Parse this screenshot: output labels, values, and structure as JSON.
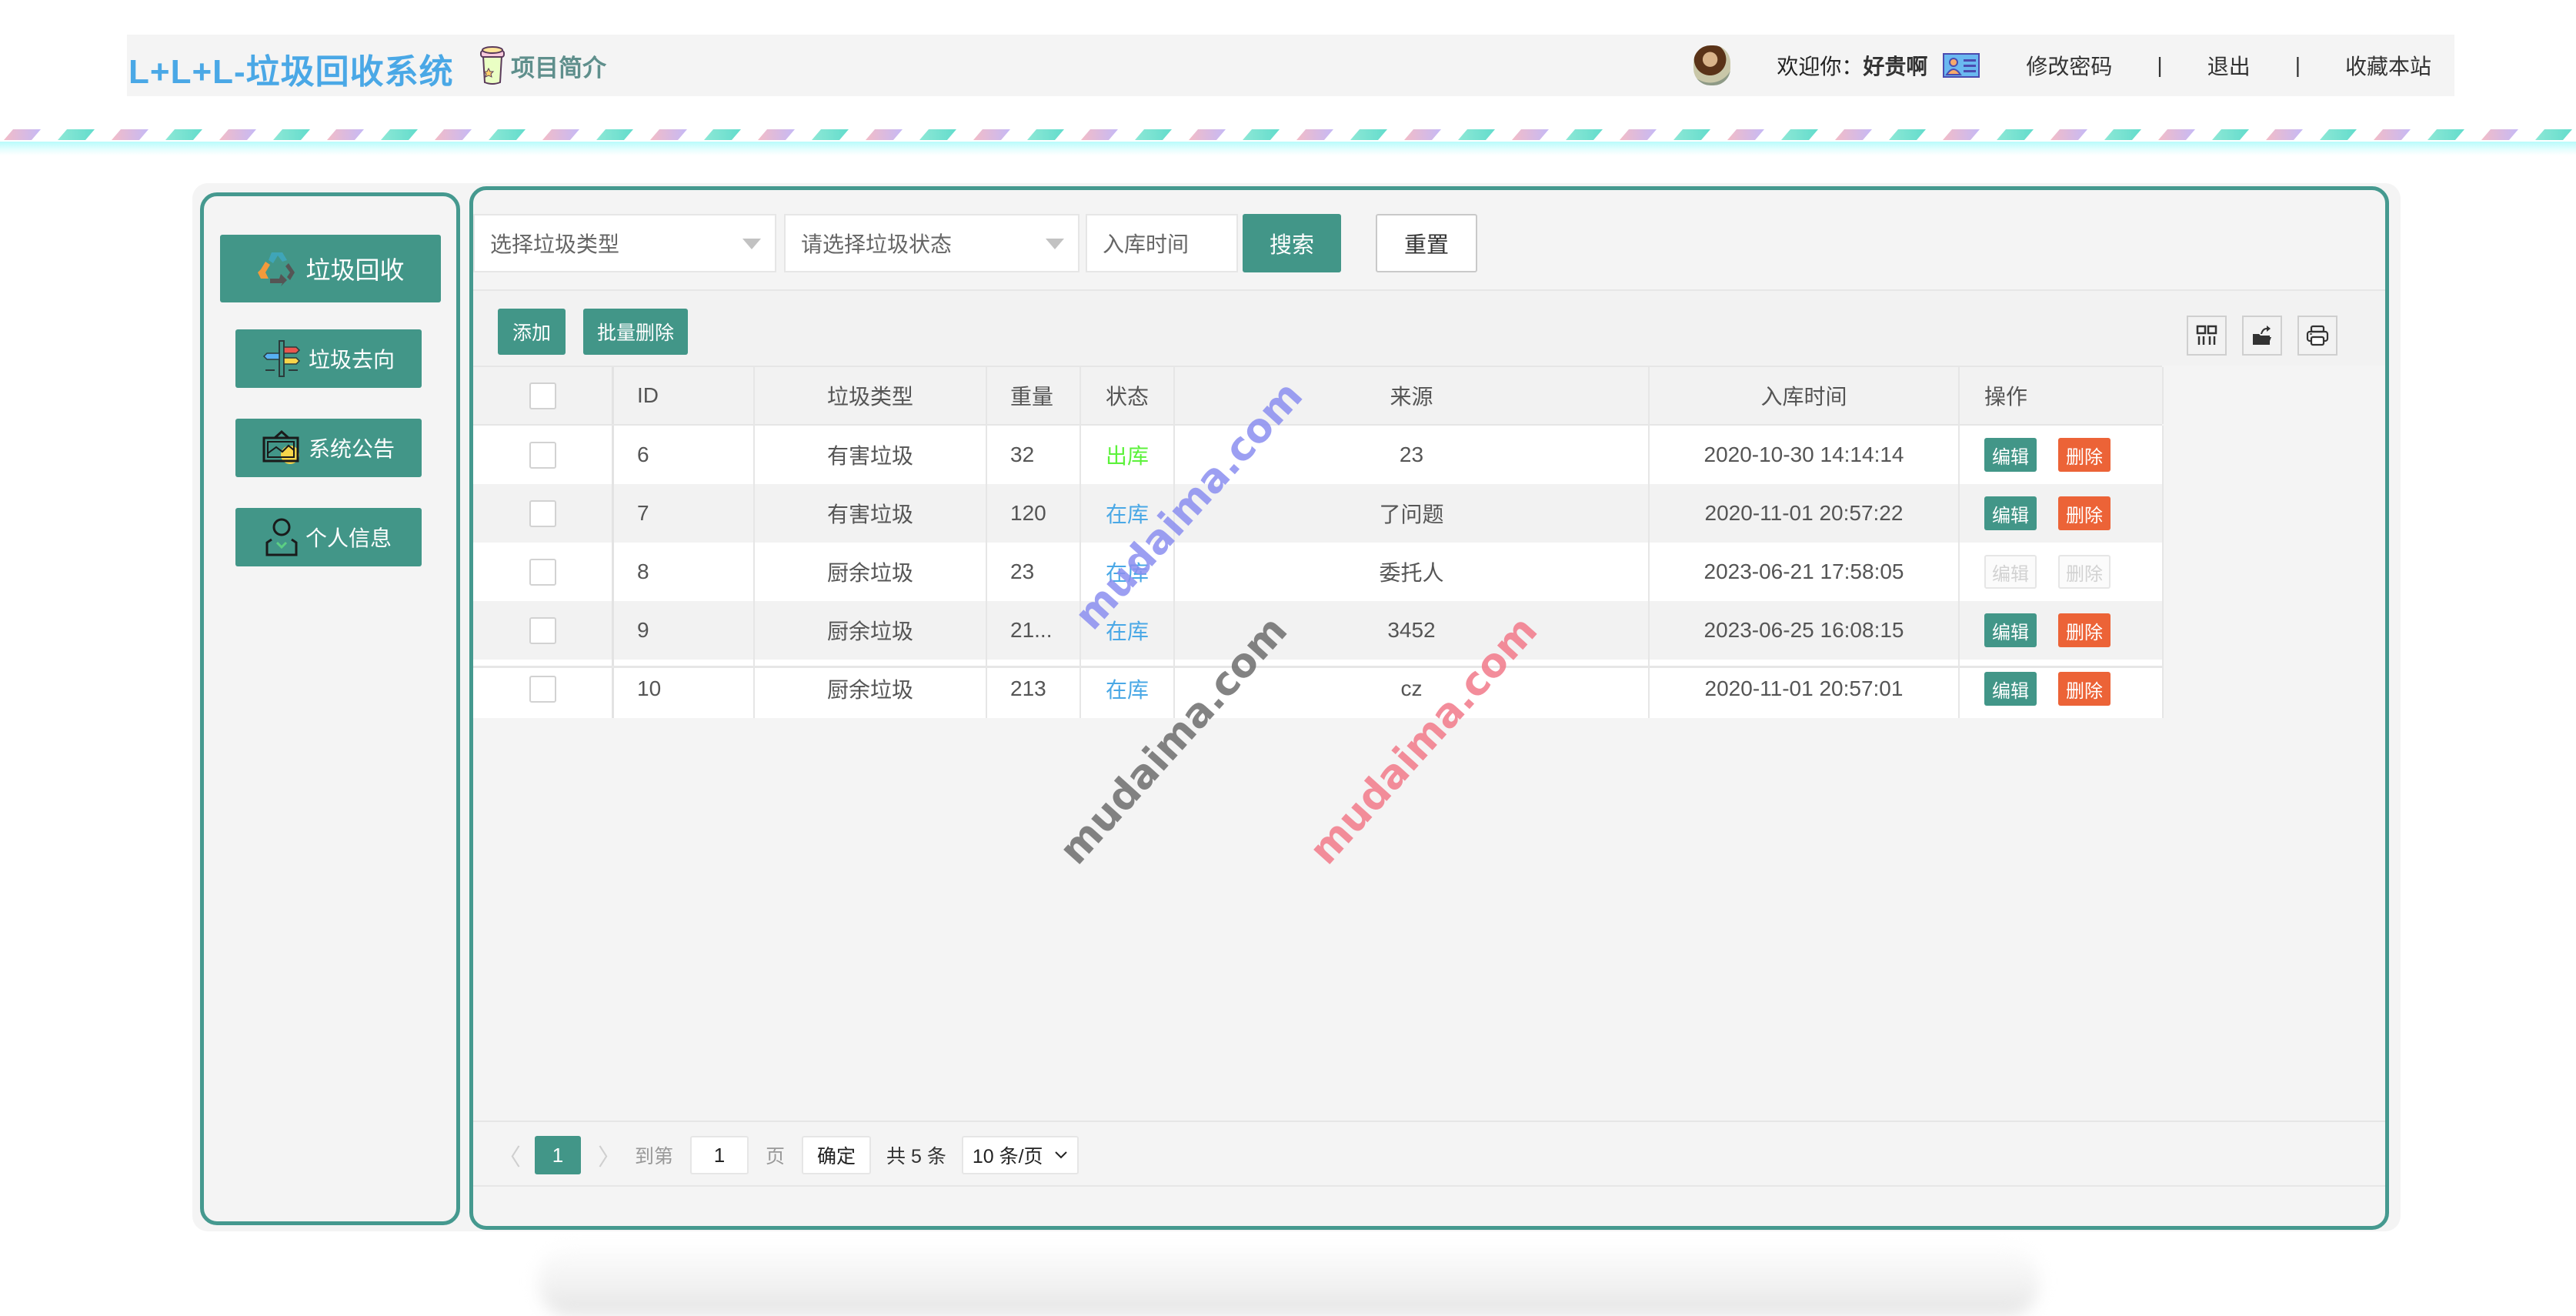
{
  "header": {
    "title": "L+L+L-垃圾回收系统",
    "intro_link": "项目简介",
    "welcome_prefix": "欢迎你：",
    "username": "好贵啊",
    "change_password": "修改密码",
    "separator": "|",
    "logout": "退出",
    "bookmark": "收藏本站"
  },
  "sidebar": {
    "items": [
      {
        "label": "垃圾回收",
        "icon": "recycle-icon",
        "active": true
      },
      {
        "label": "垃圾去向",
        "icon": "signpost-icon",
        "active": false
      },
      {
        "label": "系统公告",
        "icon": "picture-board-icon",
        "active": false
      },
      {
        "label": "个人信息",
        "icon": "user-profile-icon",
        "active": false
      }
    ]
  },
  "search": {
    "type_placeholder": "选择垃圾类型",
    "status_placeholder": "请选择垃圾状态",
    "time_placeholder": "入库时间",
    "search_label": "搜索",
    "reset_label": "重置"
  },
  "toolbar": {
    "add_label": "添加",
    "batch_delete_label": "批量删除",
    "icons": [
      "columns-filter-icon",
      "export-icon",
      "print-icon"
    ]
  },
  "table": {
    "columns": [
      "ID",
      "垃圾类型",
      "重量",
      "状态",
      "来源",
      "入库时间",
      "操作"
    ],
    "rows": [
      {
        "id": "6",
        "type": "有害垃圾",
        "weight": "32",
        "status": "出库",
        "status_kind": "out",
        "source": "23",
        "time": "2020-10-30 14:14:14",
        "edit": "编辑",
        "delete": "删除",
        "disabled": false
      },
      {
        "id": "7",
        "type": "有害垃圾",
        "weight": "120",
        "status": "在库",
        "status_kind": "in",
        "source": "了问题",
        "time": "2020-11-01 20:57:22",
        "edit": "编辑",
        "delete": "删除",
        "disabled": false
      },
      {
        "id": "8",
        "type": "厨余垃圾",
        "weight": "23",
        "status": "在库",
        "status_kind": "in",
        "source": "委托人",
        "time": "2023-06-21 17:58:05",
        "edit": "编辑",
        "delete": "删除",
        "disabled": true
      },
      {
        "id": "9",
        "type": "厨余垃圾",
        "weight": "21...",
        "status": "在库",
        "status_kind": "in",
        "source": "3452",
        "time": "2023-06-25 16:08:15",
        "edit": "编辑",
        "delete": "删除",
        "disabled": false
      },
      {
        "id": "10",
        "type": "厨余垃圾",
        "weight": "213",
        "status": "在库",
        "status_kind": "in",
        "source": "cz",
        "time": "2020-11-01 20:57:01",
        "edit": "编辑",
        "delete": "删除",
        "disabled": false
      }
    ]
  },
  "pagination": {
    "current_page": "1",
    "goto_label": "到第",
    "goto_value": "1",
    "page_unit": "页",
    "confirm_label": "确定",
    "total_label": "共 5 条",
    "page_size": "10 条/页"
  },
  "watermark": "mudaima.com",
  "colors": {
    "brand": "#429688",
    "title": "#4aa8e6",
    "status_out": "#5cf23b",
    "status_in": "#4aa8e6",
    "danger": "#ec6337"
  }
}
